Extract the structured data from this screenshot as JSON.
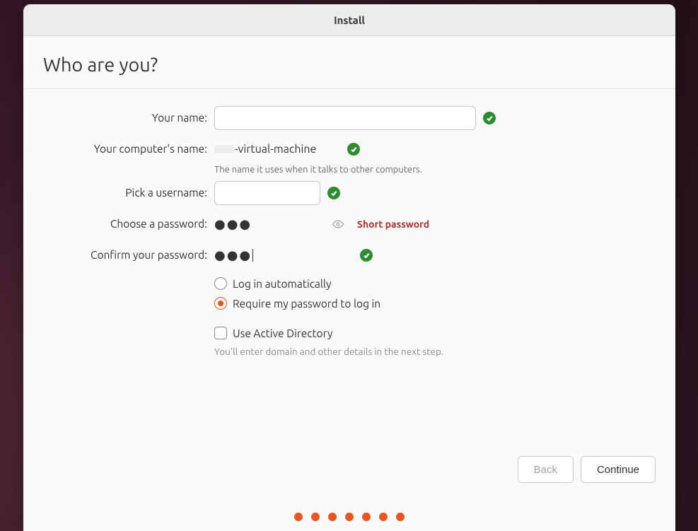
{
  "window": {
    "title": "Install"
  },
  "heading": "Who are you?",
  "form": {
    "name": {
      "label": "Your name:",
      "value_redacted": true,
      "valid": true
    },
    "host": {
      "label": "Your computer's name:",
      "value": "-virtual-machine",
      "value_prefix_redacted": true,
      "hint": "The name it uses when it talks to other computers.",
      "valid": true
    },
    "user": {
      "label": "Pick a username:",
      "value_redacted": true,
      "valid": true
    },
    "password": {
      "label": "Choose a password:",
      "mask": "●●●",
      "strength": "Short password"
    },
    "confirm": {
      "label": "Confirm your password:",
      "mask": "●●●",
      "valid": true,
      "focused": true
    },
    "login_mode": {
      "auto": "Log in automatically",
      "require": "Require my password to log in",
      "selected": "require"
    },
    "ad": {
      "label": "Use Active Directory",
      "checked": false,
      "note": "You'll enter domain and other details in the next step."
    }
  },
  "buttons": {
    "back": "Back",
    "continue": "Continue",
    "back_enabled": false
  },
  "pager": {
    "total": 7
  }
}
